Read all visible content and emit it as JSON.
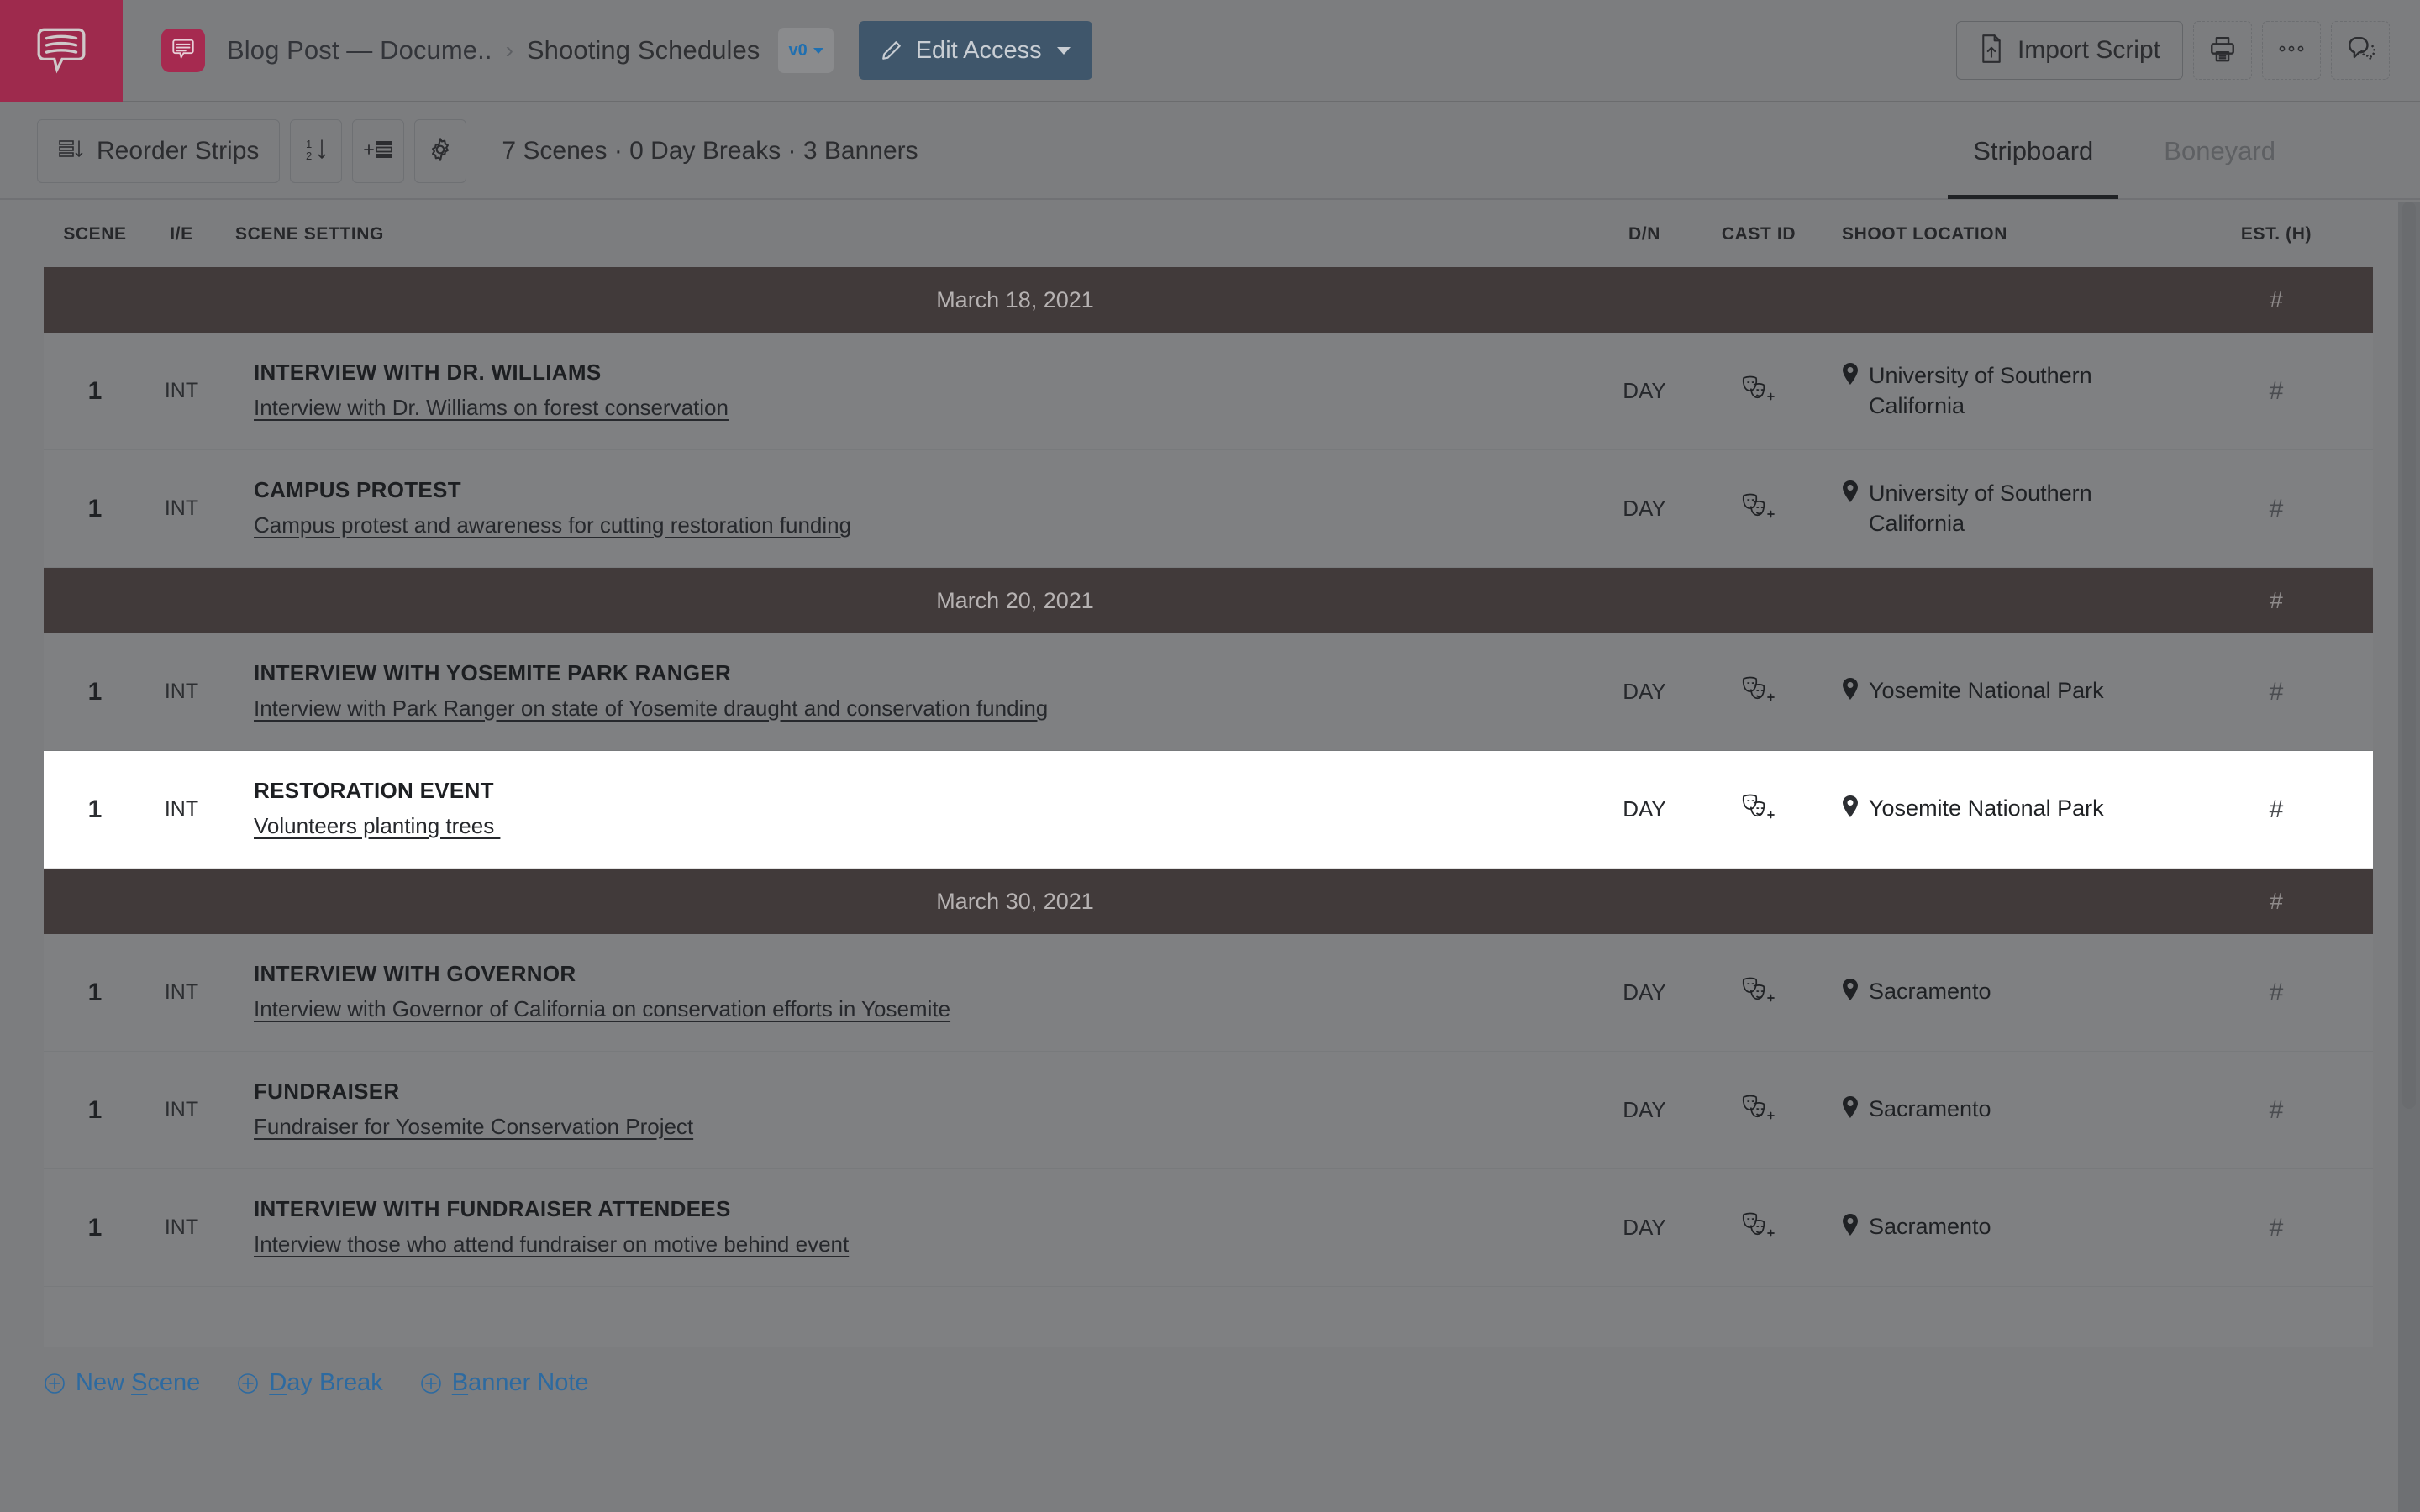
{
  "header": {
    "logo_icon": "speech-bubble-script-icon",
    "doc_badge_icon": "document-bubble-icon",
    "breadcrumb": {
      "parent": "Blog Post — Docume..",
      "separator": "›",
      "current": "Shooting Schedules"
    },
    "version_badge": {
      "label": "v0",
      "chevron_icon": "chevron-down-icon"
    },
    "edit_access": {
      "label": "Edit Access",
      "pencil_icon": "pencil-icon",
      "chevron_icon": "chevron-down-icon"
    },
    "import_script": {
      "label": "Import Script",
      "icon": "file-upload-icon"
    },
    "print_button_icon": "printer-icon",
    "more_button_icon": "ellipsis-icon",
    "comments_button_icon": "comment-bubbles-icon"
  },
  "toolbar": {
    "reorder_strips": {
      "label": "Reorder Strips",
      "icon": "reorder-rows-icon"
    },
    "sort_button_icon": "sort-ascending-1-2-icon",
    "add_strip_button_icon": "add-strip-icon",
    "settings_button_icon": "gear-icon",
    "summary": "7 Scenes · 0 Day Breaks · 3 Banners",
    "tabs": [
      {
        "label": "Stripboard",
        "active": true
      },
      {
        "label": "Boneyard",
        "active": false
      }
    ]
  },
  "table": {
    "columns": {
      "scene": "SCENE",
      "ie": "I/E",
      "setting": "SCENE SETTING",
      "dn": "D/N",
      "cast_id": "CAST ID",
      "shoot_location": "SHOOT LOCATION",
      "est_h": "EST. (H)"
    },
    "est_placeholder": "#",
    "cast_icon": "theater-masks-add-icon",
    "location_icon": "map-pin-icon",
    "rows": [
      {
        "kind": "banner",
        "date": "March 18, 2021",
        "est": "#"
      },
      {
        "kind": "scene",
        "scene": "1",
        "ie": "INT",
        "title": "INTERVIEW WITH DR. WILLIAMS",
        "description": "Interview with Dr. Williams on forest conservation",
        "dn": "DAY",
        "location": "University of Southern California",
        "est": "#",
        "selected": false
      },
      {
        "kind": "scene",
        "scene": "1",
        "ie": "INT",
        "title": "CAMPUS PROTEST",
        "description": "Campus protest and awareness for cutting restoration funding",
        "dn": "DAY",
        "location": "University of Southern California",
        "est": "#",
        "selected": false
      },
      {
        "kind": "banner",
        "date": "March 20, 2021",
        "est": "#"
      },
      {
        "kind": "scene",
        "scene": "1",
        "ie": "INT",
        "title": "INTERVIEW WITH YOSEMITE PARK RANGER",
        "description": "Interview with Park Ranger on state of Yosemite draught and conservation funding",
        "dn": "DAY",
        "location": "Yosemite National Park",
        "est": "#",
        "selected": false
      },
      {
        "kind": "scene",
        "scene": "1",
        "ie": "INT",
        "title": "RESTORATION EVENT",
        "description": "Volunteers planting trees ",
        "dn": "DAY",
        "location": "Yosemite National Park",
        "est": "#",
        "selected": true
      },
      {
        "kind": "banner",
        "date": "March 30, 2021",
        "est": "#"
      },
      {
        "kind": "scene",
        "scene": "1",
        "ie": "INT",
        "title": "INTERVIEW WITH GOVERNOR",
        "description": "Interview with Governor of California on conservation efforts in Yosemite",
        "dn": "DAY",
        "location": "Sacramento",
        "est": "#",
        "selected": false
      },
      {
        "kind": "scene",
        "scene": "1",
        "ie": "INT",
        "title": "FUNDRAISER",
        "description": "Fundraiser for Yosemite Conservation Project",
        "dn": "DAY",
        "location": "Sacramento",
        "est": "#",
        "selected": false
      },
      {
        "kind": "scene",
        "scene": "1",
        "ie": "INT",
        "title": "INTERVIEW WITH FUNDRAISER ATTENDEES",
        "description": "Interview those who attend fundraiser on motive behind event",
        "dn": "DAY",
        "location": "Sacramento",
        "est": "#",
        "selected": false
      }
    ]
  },
  "footer_actions": [
    {
      "label": "New Scene",
      "accel": "S",
      "icon": "plus-circle-icon"
    },
    {
      "label": "Day Break",
      "accel": "D",
      "icon": "plus-circle-icon"
    },
    {
      "label": "Banner Note",
      "accel": "B",
      "icon": "plus-circle-icon"
    }
  ],
  "colors": {
    "brand": "#9e2a4d",
    "page_bg": "#7c7d7f",
    "row_bg": "#7f8082",
    "banner_bg": "#413a3a",
    "selected_row_bg": "#ffffff",
    "edit_access_bg": "#3f566b",
    "link_blue": "#2d6aa0",
    "version_blue": "#1f6fb0"
  }
}
